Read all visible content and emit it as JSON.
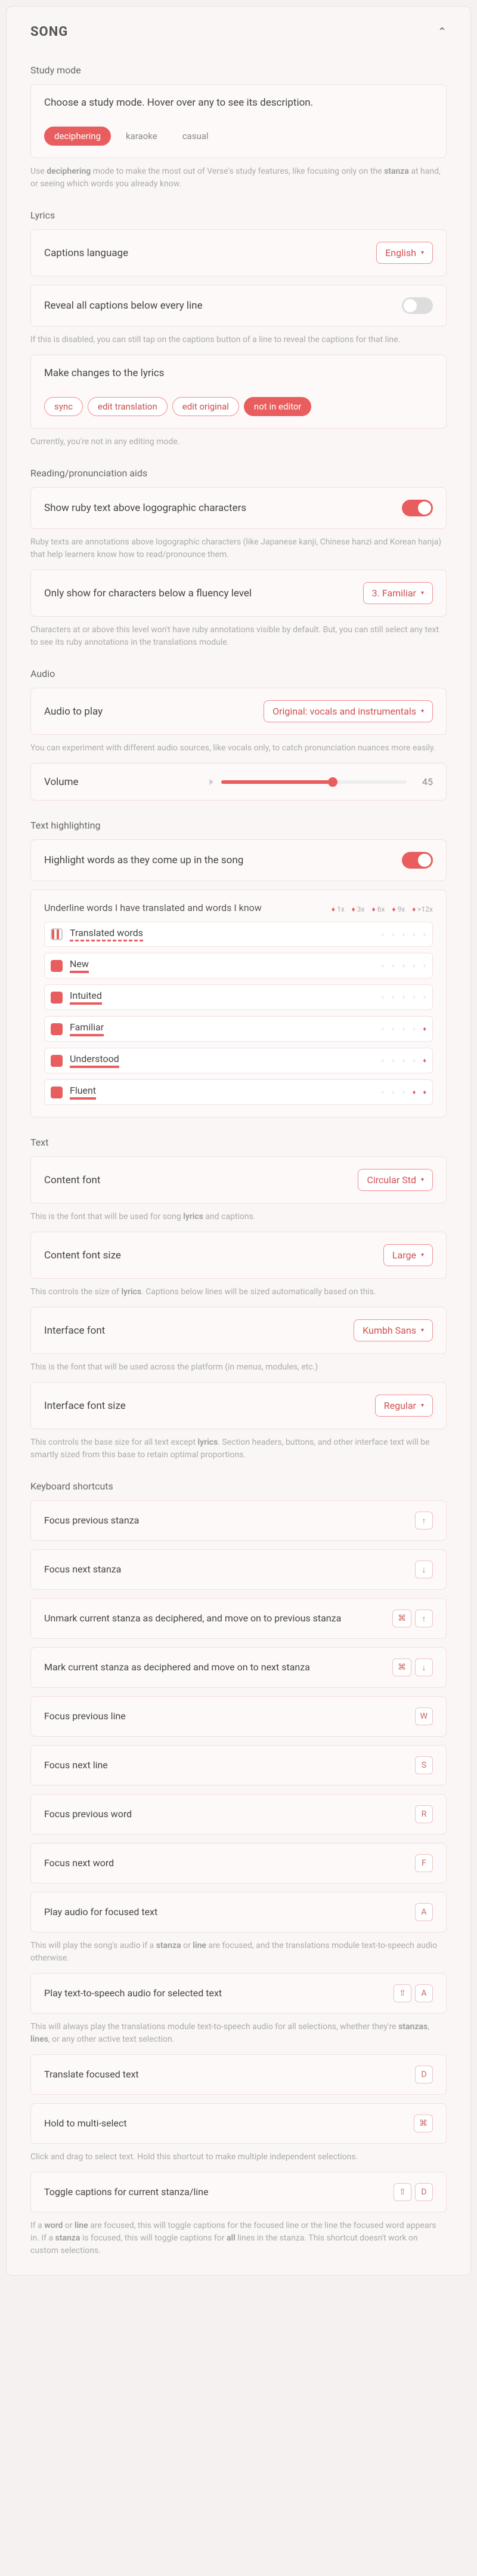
{
  "header": {
    "title": "SONG"
  },
  "studyMode": {
    "title": "Study mode",
    "prompt": "Choose a study mode. Hover over any to see its description.",
    "modes": [
      "deciphering",
      "karaoke",
      "casual"
    ],
    "active": "deciphering",
    "note": "Use <b>deciphering</b> mode to make the most out of Verse's study features, like focusing only on the <b>stanza</b> at hand, or seeing which words you already know."
  },
  "lyrics": {
    "title": "Lyrics",
    "captionsLang": {
      "label": "Captions language",
      "value": "English"
    },
    "revealAll": {
      "label": "Reveal all captions below every line",
      "on": false,
      "note": "If this is disabled, you can still tap on the captions button of a line to reveal the captions for that line."
    },
    "makeChanges": {
      "label": "Make changes to the lyrics",
      "options": [
        "sync",
        "edit translation",
        "edit original",
        "not in editor"
      ],
      "active": "not in editor",
      "note": "Currently, you're not in any editing mode."
    }
  },
  "aids": {
    "title": "Reading/pronunciation aids",
    "ruby": {
      "label": "Show ruby text above logographic characters",
      "on": true,
      "note": "Ruby texts are annotations above logographic characters (like Japanese kanji, Chinese hanzi and Korean hanja) that help learners know how to read/pronounce them."
    },
    "fluency": {
      "label": "Only show for characters below a fluency level",
      "value": "3. Familiar",
      "note": "Characters at or above this level won't have ruby annotations visible by default. But, you can still select any text to see its ruby annotations in the translations module."
    }
  },
  "audio": {
    "title": "Audio",
    "source": {
      "label": "Audio to play",
      "value": "Original: vocals and instrumentals",
      "note": "You can experiment with different audio sources, like vocals only, to catch pronunciation nuances more easily."
    },
    "volume": {
      "label": "Volume",
      "value": "45"
    }
  },
  "highlighting": {
    "title": "Text highlighting",
    "highlightWords": {
      "label": "Highlight words as they come up in the song",
      "on": true
    },
    "underline": {
      "title": "Underline words I have translated and words I know"
    },
    "dropLegend": [
      "1x",
      "3x",
      "6x",
      "9x",
      ">12x"
    ],
    "rows": [
      {
        "name": "Translated words",
        "checked": "dash",
        "style": "dashed"
      },
      {
        "name": "New",
        "checked": true,
        "style": "solid"
      },
      {
        "name": "Intuited",
        "checked": true,
        "style": "solid"
      },
      {
        "name": "Familiar",
        "checked": true,
        "style": "solid"
      },
      {
        "name": "Understood",
        "checked": true,
        "style": "solid"
      },
      {
        "name": "Fluent",
        "checked": true,
        "style": "solid"
      }
    ]
  },
  "text": {
    "title": "Text",
    "contentFont": {
      "label": "Content font",
      "value": "Circular Std",
      "note": "This is the font that will be used for song <b>lyrics</b> and captions."
    },
    "contentSize": {
      "label": "Content font size",
      "value": "Large",
      "note": "This controls the size of <b>lyrics</b>. Captions below lines will be sized automatically based on this."
    },
    "interfaceFont": {
      "label": "Interface font",
      "value": "Kumbh Sans",
      "note": "This is the font that will be used across the platform (in menus, modules, etc.)"
    },
    "interfaceSize": {
      "label": "Interface font size",
      "value": "Regular",
      "note": "This controls the base size for all text except <b>lyrics</b>. Section headers, buttons, and other interface text will be smartly sized from this base to retain optimal proportions."
    }
  },
  "shortcuts": {
    "title": "Keyboard shortcuts",
    "items": [
      {
        "label": "Focus previous stanza",
        "keys": [
          "↑"
        ]
      },
      {
        "label": "Focus next stanza",
        "keys": [
          "↓"
        ]
      },
      {
        "label": "Unmark current stanza as deciphered, and move on to previous stanza",
        "keys": [
          "⌘",
          "↑"
        ]
      },
      {
        "label": "Mark current stanza as deciphered and move on to next stanza",
        "keys": [
          "⌘",
          "↓"
        ]
      },
      {
        "label": "Focus previous line",
        "keys": [
          "W"
        ]
      },
      {
        "label": "Focus next line",
        "keys": [
          "S"
        ]
      },
      {
        "label": "Focus previous word",
        "keys": [
          "R"
        ]
      },
      {
        "label": "Focus next word",
        "keys": [
          "F"
        ]
      },
      {
        "label": "Play audio for focused text",
        "keys": [
          "A"
        ],
        "note": "This will play the song's audio if a <b>stanza</b> or <b>line</b> are focused, and the translations module text-to-speech audio otherwise."
      },
      {
        "label": "Play text-to-speech audio for selected text",
        "keys": [
          "⇧",
          "A"
        ],
        "note": "This will always play the translations module text-to-speech audio for all selections, whether they're <b>stanzas</b>, <b>lines</b>, or any other active text selection."
      },
      {
        "label": "Translate focused text",
        "keys": [
          "D"
        ]
      },
      {
        "label": "Hold to multi-select",
        "keys": [
          "⌘"
        ],
        "note": "Click and drag to select text. Hold this shortcut to make multiple independent selections."
      },
      {
        "label": "Toggle captions for current stanza/line",
        "keys": [
          "⇧",
          "D"
        ],
        "note": "If a <b>word</b> or <b>line</b> are focused, this will toggle captions for the focused line or the line the focused word appears in. If a <b>stanza</b> is focused, this will toggle captions for <b>all</b> lines in the stanza. This shortcut doesn't work on custom selections."
      }
    ]
  }
}
